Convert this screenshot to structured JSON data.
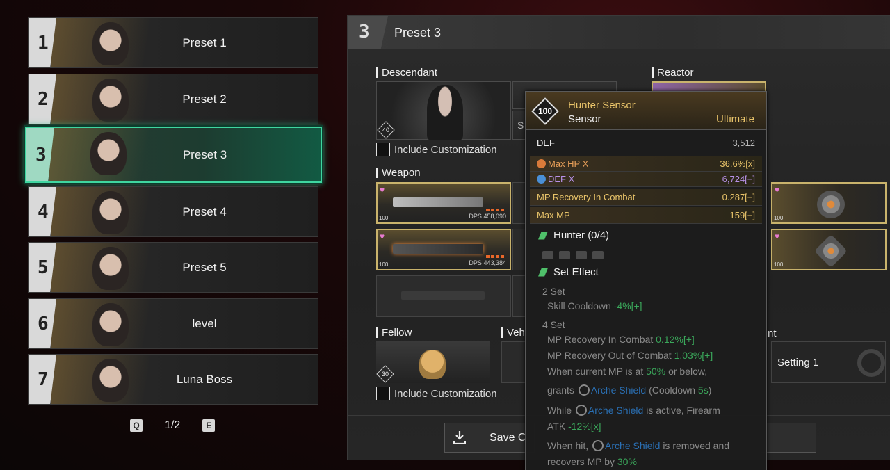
{
  "presets": [
    {
      "num": "1",
      "label": "Preset 1"
    },
    {
      "num": "2",
      "label": "Preset 2"
    },
    {
      "num": "3",
      "label": "Preset 3"
    },
    {
      "num": "4",
      "label": "Preset 4"
    },
    {
      "num": "5",
      "label": "Preset 5"
    },
    {
      "num": "6",
      "label": "level"
    },
    {
      "num": "7",
      "label": "Luna Boss"
    }
  ],
  "pager": {
    "prev_key": "Q",
    "page": "1/2",
    "next_key": "E"
  },
  "panel": {
    "num": "3",
    "title": "Preset 3",
    "descendant_title": "Descendant",
    "descendant_level": "40",
    "reactor_title": "Reactor",
    "include_customization": "Include Customization",
    "weapon_title": "Weapon",
    "weapons": [
      {
        "dps_label": "DPS",
        "dps": "458,090",
        "tier": "100"
      },
      {
        "dps_label": "DPS",
        "dps": "443,384",
        "tier": "100"
      }
    ],
    "fellow_title": "Fellow",
    "fellow_level": "30",
    "vehicle_title": "Vehi",
    "setting_partial": "nt",
    "setting_label": "Setting 1",
    "save_label": "Save C",
    "partial_slot_text": "S"
  },
  "tooltip": {
    "level": "100",
    "name": "Hunter Sensor",
    "type": "Sensor",
    "grade": "Ultimate",
    "base_stat": {
      "label": "DEF",
      "value": "3,512"
    },
    "stats": [
      {
        "label": "Max HP X",
        "value": "36.6%[x]"
      },
      {
        "label": "DEF X",
        "value": "6,724[+]"
      },
      {
        "label": "MP Recovery In Combat",
        "value": "0.287[+]"
      },
      {
        "label": "Max MP",
        "value": "159[+]"
      }
    ],
    "set_name": "Hunter (0/4)",
    "set_effect_title": "Set Effect",
    "two_set": "2 Set",
    "two_set_effect": "Skill Cooldown",
    "two_set_value": "-4%[+]",
    "four_set": "4 Set",
    "four_lines": [
      {
        "text": "MP Recovery In Combat",
        "value": "0.12%[+]"
      },
      {
        "text": "MP Recovery Out of Combat",
        "value": "1.03%[+]"
      }
    ],
    "mp_line_a": "When current MP is at",
    "mp_line_pct": "50%",
    "mp_line_b": "or below,",
    "grants": "grants",
    "shield_name": "Arche Shield",
    "cooldown_a": "(Cooldown",
    "cooldown_val": "5s",
    "cooldown_b": ")",
    "while": "While",
    "active_text": "is active, Firearm",
    "atk": "ATK",
    "atk_val": "-12%[x]",
    "when_hit": "When hit,",
    "removed_text": "is removed and",
    "recovers": "recovers MP by",
    "recovers_val": "30%"
  },
  "colors": {
    "accent_green": "#3fd6a0",
    "gold": "#e9c46a",
    "set_green": "#3aa65a",
    "shield_blue": "#2a6fb3"
  }
}
